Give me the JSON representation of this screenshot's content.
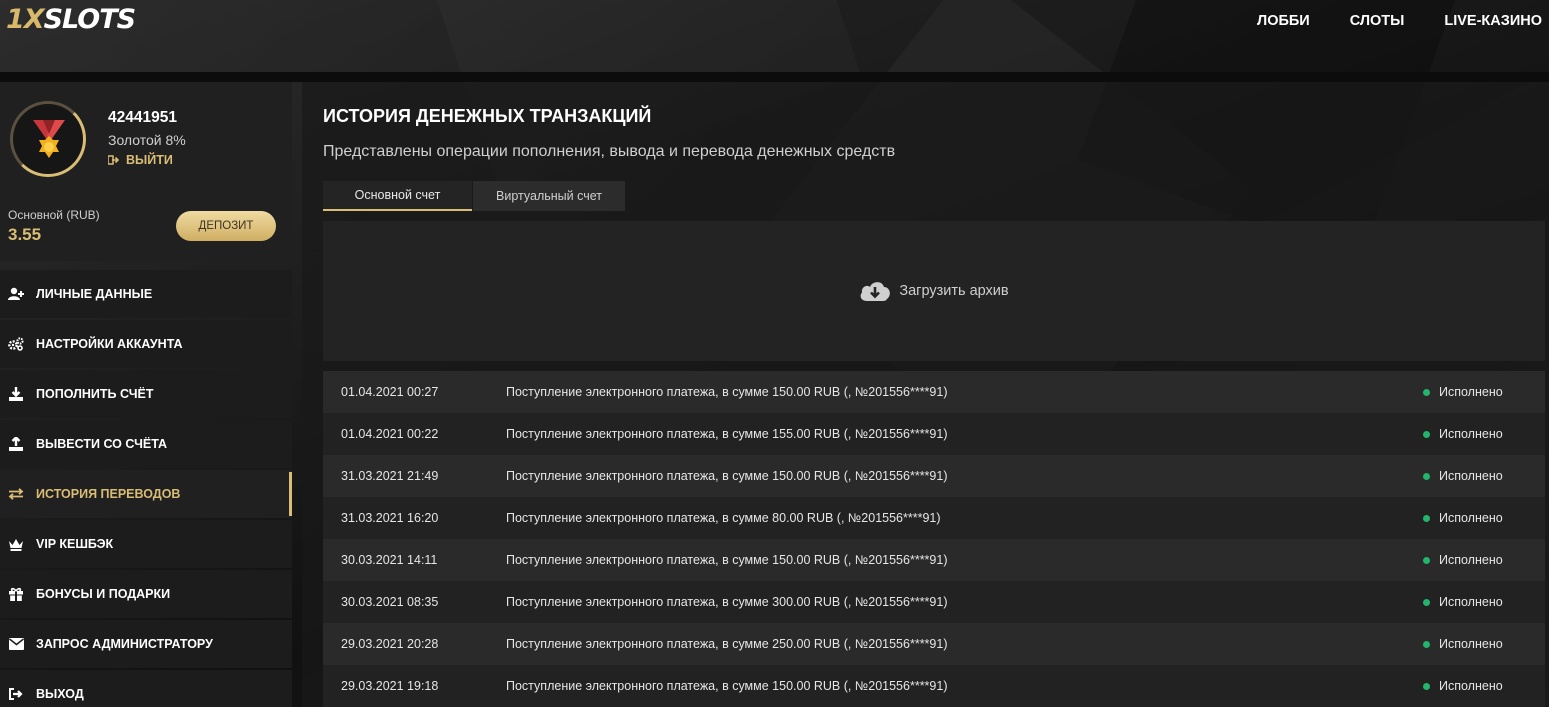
{
  "colors": {
    "accent": "#d9bd74",
    "status_ok": "#23b56b"
  },
  "header": {
    "logo_prefix": "1X",
    "logo_suffix": "SLOTS",
    "nav": [
      {
        "label": "ЛОББИ"
      },
      {
        "label": "СЛОТЫ"
      },
      {
        "label": "LIVE-КАЗИНО"
      }
    ]
  },
  "profile": {
    "user_id": "42441951",
    "level": "Золотой 8%",
    "logout_label": "ВЫЙТИ",
    "balance_label": "Основной (RUB)",
    "balance_value": "3.55",
    "deposit_label": "ДЕПОЗИТ"
  },
  "menu": [
    {
      "label": "ЛИЧНЫЕ ДАННЫЕ",
      "icon": "user-add-icon"
    },
    {
      "label": "НАСТРОЙКИ АККАУНТА",
      "icon": "gears-icon"
    },
    {
      "label": "ПОПОЛНИТЬ СЧЁТ",
      "icon": "download-icon"
    },
    {
      "label": "ВЫВЕСТИ СО СЧЁТА",
      "icon": "upload-icon"
    },
    {
      "label": "ИСТОРИЯ ПЕРЕВОДОВ",
      "icon": "transfer-arrows-icon",
      "active": true
    },
    {
      "label": "VIP КЕШБЭК",
      "icon": "crown-icon"
    },
    {
      "label": "БОНУСЫ И ПОДАРКИ",
      "icon": "gift-icon"
    },
    {
      "label": "ЗАПРОС АДМИНИСТРАТОРУ",
      "icon": "envelope-icon"
    },
    {
      "label": "ВЫХОД",
      "icon": "sign-out-icon"
    }
  ],
  "main": {
    "title": "ИСТОРИЯ ДЕНЕЖНЫХ ТРАНЗАКЦИЙ",
    "subtitle": "Представлены операции пополнения, вывода и перевода денежных средств",
    "tabs": [
      {
        "label": "Основной счет",
        "active": true
      },
      {
        "label": "Виртуальный счет"
      }
    ],
    "archive_label": "Загрузить архив",
    "transactions": [
      {
        "date": "01.04.2021 00:27",
        "desc": "Поступление электронного платежа, в сумме 150.00 RUB (, №201556****91)",
        "status": "Исполнено"
      },
      {
        "date": "01.04.2021 00:22",
        "desc": "Поступление электронного платежа, в сумме 155.00 RUB (, №201556****91)",
        "status": "Исполнено"
      },
      {
        "date": "31.03.2021 21:49",
        "desc": "Поступление электронного платежа, в сумме 150.00 RUB (, №201556****91)",
        "status": "Исполнено"
      },
      {
        "date": "31.03.2021 16:20",
        "desc": "Поступление электронного платежа, в сумме 80.00 RUB (, №201556****91)",
        "status": "Исполнено"
      },
      {
        "date": "30.03.2021 14:11",
        "desc": "Поступление электронного платежа, в сумме 150.00 RUB (, №201556****91)",
        "status": "Исполнено"
      },
      {
        "date": "30.03.2021 08:35",
        "desc": "Поступление электронного платежа, в сумме 300.00 RUB (, №201556****91)",
        "status": "Исполнено"
      },
      {
        "date": "29.03.2021 20:28",
        "desc": "Поступление электронного платежа, в сумме 250.00 RUB (, №201556****91)",
        "status": "Исполнено"
      },
      {
        "date": "29.03.2021 19:18",
        "desc": "Поступление электронного платежа, в сумме 150.00 RUB (, №201556****91)",
        "status": "Исполнено"
      }
    ]
  }
}
